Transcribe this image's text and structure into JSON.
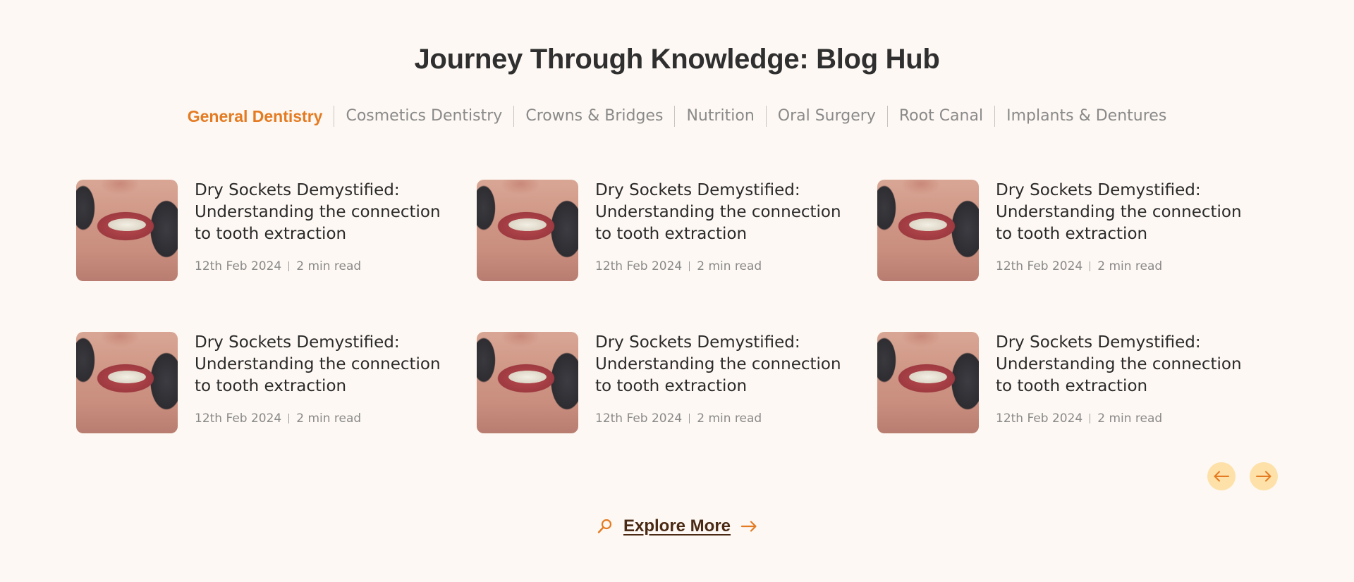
{
  "header": {
    "title": "Journey Through Knowledge: Blog Hub"
  },
  "tabs": [
    {
      "label": "General Dentistry",
      "active": true
    },
    {
      "label": "Cosmetics Dentistry",
      "active": false
    },
    {
      "label": "Crowns & Bridges",
      "active": false
    },
    {
      "label": "Nutrition",
      "active": false
    },
    {
      "label": "Oral Surgery",
      "active": false
    },
    {
      "label": "Root Canal",
      "active": false
    },
    {
      "label": "Implants & Dentures",
      "active": false
    }
  ],
  "posts": [
    {
      "title": "Dry Sockets Demystified: Understanding the connection to tooth extraction",
      "date": "12th Feb 2024",
      "read_time": "2 min read"
    },
    {
      "title": "Dry Sockets Demystified: Understanding the connection to tooth extraction",
      "date": "12th Feb 2024",
      "read_time": "2 min read"
    },
    {
      "title": "Dry Sockets Demystified: Understanding the connection to tooth extraction",
      "date": "12th Feb 2024",
      "read_time": "2 min read"
    },
    {
      "title": "Dry Sockets Demystified: Understanding the connection to tooth extraction",
      "date": "12th Feb 2024",
      "read_time": "2 min read"
    },
    {
      "title": "Dry Sockets Demystified: Understanding the connection to tooth extraction",
      "date": "12th Feb 2024",
      "read_time": "2 min read"
    },
    {
      "title": "Dry Sockets Demystified: Understanding the connection to tooth extraction",
      "date": "12th Feb 2024",
      "read_time": "2 min read"
    }
  ],
  "carousel": {
    "prev_icon": "arrow-left-icon",
    "next_icon": "arrow-right-icon"
  },
  "explore": {
    "label": "Explore More",
    "icon": "search-icon",
    "arrow_icon": "arrow-right-icon"
  },
  "colors": {
    "background": "#fdf8f3",
    "accent": "#e47b22",
    "nav_button_bg": "#fde1a8",
    "explore_text": "#4a2a14"
  }
}
